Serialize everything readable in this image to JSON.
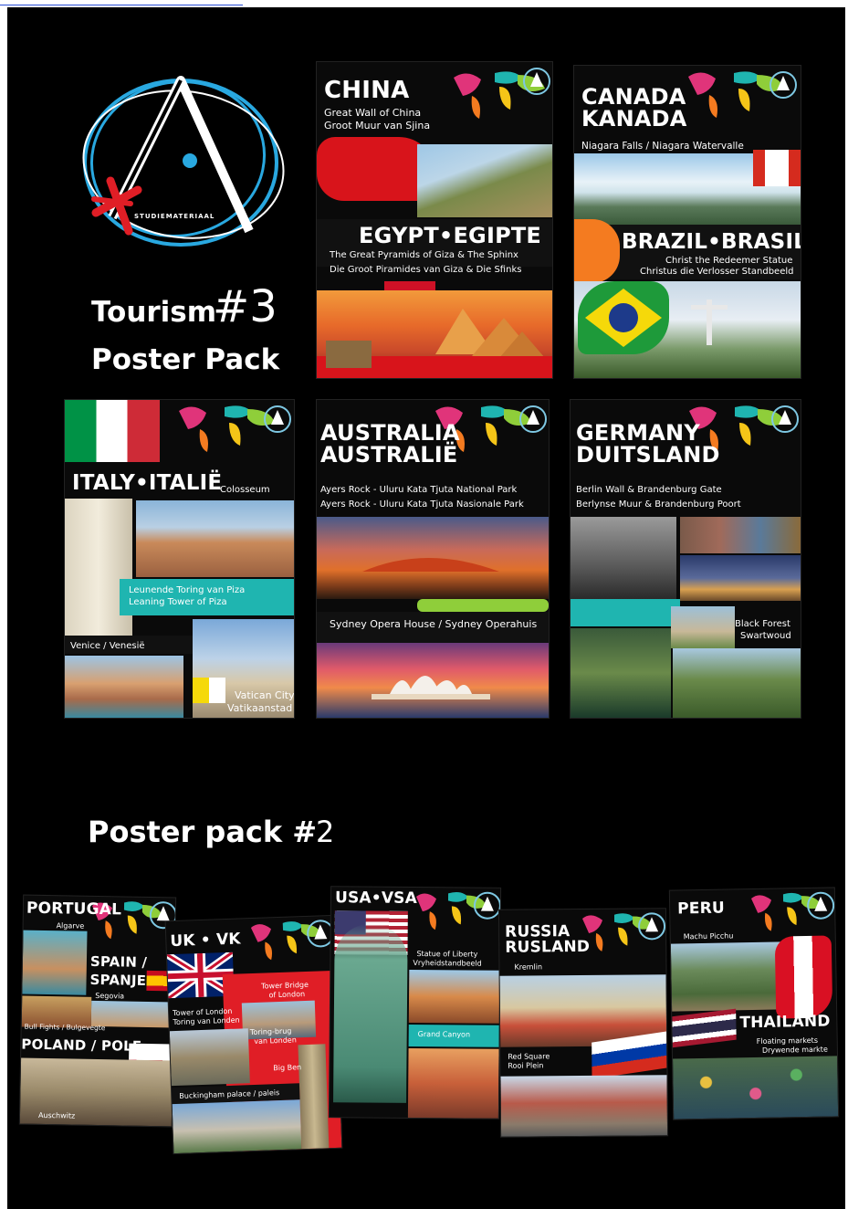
{
  "brand": {
    "logo_text": "STUDIEMATERIAAL",
    "pack_title": "Tourism",
    "pack_number": "#3",
    "pack_subtitle": "Poster Pack"
  },
  "pack3_posters": [
    {
      "title": "CHINA",
      "lines": [
        "Great Wall of China",
        "Groot Muur van Sjina"
      ]
    },
    {
      "title": "CANADA\nKANADA",
      "lines": [
        "Niagara Falls / Niagara Watervalle"
      ]
    },
    {
      "title": "EGYPT•EGIPTE",
      "lines": [
        "The Great Pyramids of Giza & The Sphinx",
        "Die Groot Piramides van Giza & Die Sfinks"
      ]
    },
    {
      "title": "BRAZIL•BRASILIË",
      "lines": [
        "Christ the Redeemer Statue",
        "Christus die Verlosser Standbeeld"
      ]
    },
    {
      "title": "ITALY•ITALIË",
      "lines": [
        "Colosseum",
        "Leunende Toring van Piza",
        "Leaning Tower of Piza",
        "Venice / Venesië",
        "Vatican City",
        "Vatikaanstad"
      ]
    },
    {
      "title": "AUSTRALIA\nAUSTRALIË",
      "lines": [
        "Ayers Rock - Uluru Kata Tjuta National Park",
        "Ayers Rock - Uluru Kata Tjuta Nasionale Park",
        "Sydney Opera House / Sydney Operahuis"
      ]
    },
    {
      "title": "GERMANY\nDUITSLAND",
      "lines": [
        "Berlin Wall & Brandenburg Gate",
        "Berlynse Muur & Brandenburg Poort",
        "Black Forest",
        "Swartwoud"
      ]
    }
  ],
  "pack2": {
    "heading": "Poster pack #",
    "number": "2",
    "posters": [
      {
        "title": "PORTUGAL",
        "lines": [
          "Algarve",
          "SPAIN /",
          "SPANJE",
          "Segovia",
          "Bull Fights / Bulgevegte",
          "POLAND / POLE",
          "Auschwitz"
        ]
      },
      {
        "title": "UK • VK",
        "lines": [
          "Tower Bridge",
          "of London",
          "Tower of London",
          "Toring van Londen",
          "Toring-brug",
          "van Londen",
          "Big Ben",
          "Buckingham palace / paleis"
        ]
      },
      {
        "title": "USA•VSA",
        "lines": [
          "Statue of Liberty",
          "Vryheidstandbeeld",
          "Grand Canyon"
        ]
      },
      {
        "title": "RUSSIA\nRUSLAND",
        "lines": [
          "Kremlin",
          "Red Square",
          "Rooi Plein"
        ]
      },
      {
        "title": "PERU",
        "lines": [
          "Machu Picchu",
          "THAILAND",
          "Floating markets",
          "Drywende markte"
        ]
      }
    ]
  },
  "colors": {
    "background": "#000000",
    "accent_teal": "#1fb5b0",
    "accent_red": "#e01e26",
    "accent_yellow": "#f5c518",
    "accent_green": "#8fce3a",
    "accent_pink": "#e0347a"
  }
}
